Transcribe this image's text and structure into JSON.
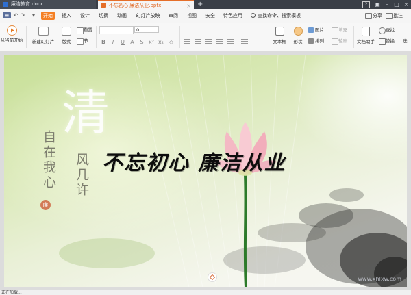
{
  "tabs": [
    {
      "label": "廉洁教育.docx",
      "active": false
    },
    {
      "label": "不忘初心 廉洁从业.pptx",
      "active": true
    }
  ],
  "window": {
    "badge": "2"
  },
  "menu": {
    "items": [
      "开始",
      "插入",
      "设计",
      "切换",
      "动画",
      "幻灯片放映",
      "审阅",
      "视图",
      "安全",
      "特色应用"
    ],
    "active": "开始",
    "search": "查找命令、搜索模板",
    "share": "分享",
    "comment": "批注"
  },
  "ribbon": {
    "play_from_current": "从当前开始",
    "new_slide": "新建幻灯片",
    "layout": "版式",
    "reset": "重置",
    "section": "节",
    "font_size": "0",
    "textbox": "文本框",
    "shape": "形状",
    "picture": "图片",
    "fill": "填充",
    "arrange": "排列",
    "outline": "轮廓",
    "doc_assistant": "文档助手",
    "find": "查找",
    "replace": "替换",
    "select": "选"
  },
  "slide": {
    "big_char": "清",
    "vertical_text_1": "自在我心",
    "vertical_text_2": "风几许",
    "seal": "廉",
    "headline": "不忘初心 廉洁从业",
    "watermark": "www.xhlxw.com"
  },
  "statusbar": {
    "text": "正在加载..."
  },
  "colors": {
    "accent": "#f47f24",
    "tabbar": "#3a3f47"
  }
}
